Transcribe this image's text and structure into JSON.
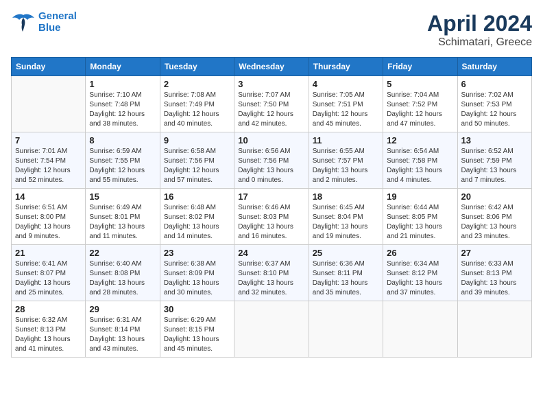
{
  "header": {
    "logo_line1": "General",
    "logo_line2": "Blue",
    "title": "April 2024",
    "subtitle": "Schimatari, Greece"
  },
  "weekdays": [
    "Sunday",
    "Monday",
    "Tuesday",
    "Wednesday",
    "Thursday",
    "Friday",
    "Saturday"
  ],
  "weeks": [
    [
      {
        "num": "",
        "info": ""
      },
      {
        "num": "1",
        "info": "Sunrise: 7:10 AM\nSunset: 7:48 PM\nDaylight: 12 hours\nand 38 minutes."
      },
      {
        "num": "2",
        "info": "Sunrise: 7:08 AM\nSunset: 7:49 PM\nDaylight: 12 hours\nand 40 minutes."
      },
      {
        "num": "3",
        "info": "Sunrise: 7:07 AM\nSunset: 7:50 PM\nDaylight: 12 hours\nand 42 minutes."
      },
      {
        "num": "4",
        "info": "Sunrise: 7:05 AM\nSunset: 7:51 PM\nDaylight: 12 hours\nand 45 minutes."
      },
      {
        "num": "5",
        "info": "Sunrise: 7:04 AM\nSunset: 7:52 PM\nDaylight: 12 hours\nand 47 minutes."
      },
      {
        "num": "6",
        "info": "Sunrise: 7:02 AM\nSunset: 7:53 PM\nDaylight: 12 hours\nand 50 minutes."
      }
    ],
    [
      {
        "num": "7",
        "info": "Sunrise: 7:01 AM\nSunset: 7:54 PM\nDaylight: 12 hours\nand 52 minutes."
      },
      {
        "num": "8",
        "info": "Sunrise: 6:59 AM\nSunset: 7:55 PM\nDaylight: 12 hours\nand 55 minutes."
      },
      {
        "num": "9",
        "info": "Sunrise: 6:58 AM\nSunset: 7:56 PM\nDaylight: 12 hours\nand 57 minutes."
      },
      {
        "num": "10",
        "info": "Sunrise: 6:56 AM\nSunset: 7:56 PM\nDaylight: 13 hours\nand 0 minutes."
      },
      {
        "num": "11",
        "info": "Sunrise: 6:55 AM\nSunset: 7:57 PM\nDaylight: 13 hours\nand 2 minutes."
      },
      {
        "num": "12",
        "info": "Sunrise: 6:54 AM\nSunset: 7:58 PM\nDaylight: 13 hours\nand 4 minutes."
      },
      {
        "num": "13",
        "info": "Sunrise: 6:52 AM\nSunset: 7:59 PM\nDaylight: 13 hours\nand 7 minutes."
      }
    ],
    [
      {
        "num": "14",
        "info": "Sunrise: 6:51 AM\nSunset: 8:00 PM\nDaylight: 13 hours\nand 9 minutes."
      },
      {
        "num": "15",
        "info": "Sunrise: 6:49 AM\nSunset: 8:01 PM\nDaylight: 13 hours\nand 11 minutes."
      },
      {
        "num": "16",
        "info": "Sunrise: 6:48 AM\nSunset: 8:02 PM\nDaylight: 13 hours\nand 14 minutes."
      },
      {
        "num": "17",
        "info": "Sunrise: 6:46 AM\nSunset: 8:03 PM\nDaylight: 13 hours\nand 16 minutes."
      },
      {
        "num": "18",
        "info": "Sunrise: 6:45 AM\nSunset: 8:04 PM\nDaylight: 13 hours\nand 19 minutes."
      },
      {
        "num": "19",
        "info": "Sunrise: 6:44 AM\nSunset: 8:05 PM\nDaylight: 13 hours\nand 21 minutes."
      },
      {
        "num": "20",
        "info": "Sunrise: 6:42 AM\nSunset: 8:06 PM\nDaylight: 13 hours\nand 23 minutes."
      }
    ],
    [
      {
        "num": "21",
        "info": "Sunrise: 6:41 AM\nSunset: 8:07 PM\nDaylight: 13 hours\nand 25 minutes."
      },
      {
        "num": "22",
        "info": "Sunrise: 6:40 AM\nSunset: 8:08 PM\nDaylight: 13 hours\nand 28 minutes."
      },
      {
        "num": "23",
        "info": "Sunrise: 6:38 AM\nSunset: 8:09 PM\nDaylight: 13 hours\nand 30 minutes."
      },
      {
        "num": "24",
        "info": "Sunrise: 6:37 AM\nSunset: 8:10 PM\nDaylight: 13 hours\nand 32 minutes."
      },
      {
        "num": "25",
        "info": "Sunrise: 6:36 AM\nSunset: 8:11 PM\nDaylight: 13 hours\nand 35 minutes."
      },
      {
        "num": "26",
        "info": "Sunrise: 6:34 AM\nSunset: 8:12 PM\nDaylight: 13 hours\nand 37 minutes."
      },
      {
        "num": "27",
        "info": "Sunrise: 6:33 AM\nSunset: 8:13 PM\nDaylight: 13 hours\nand 39 minutes."
      }
    ],
    [
      {
        "num": "28",
        "info": "Sunrise: 6:32 AM\nSunset: 8:13 PM\nDaylight: 13 hours\nand 41 minutes."
      },
      {
        "num": "29",
        "info": "Sunrise: 6:31 AM\nSunset: 8:14 PM\nDaylight: 13 hours\nand 43 minutes."
      },
      {
        "num": "30",
        "info": "Sunrise: 6:29 AM\nSunset: 8:15 PM\nDaylight: 13 hours\nand 45 minutes."
      },
      {
        "num": "",
        "info": ""
      },
      {
        "num": "",
        "info": ""
      },
      {
        "num": "",
        "info": ""
      },
      {
        "num": "",
        "info": ""
      }
    ]
  ]
}
